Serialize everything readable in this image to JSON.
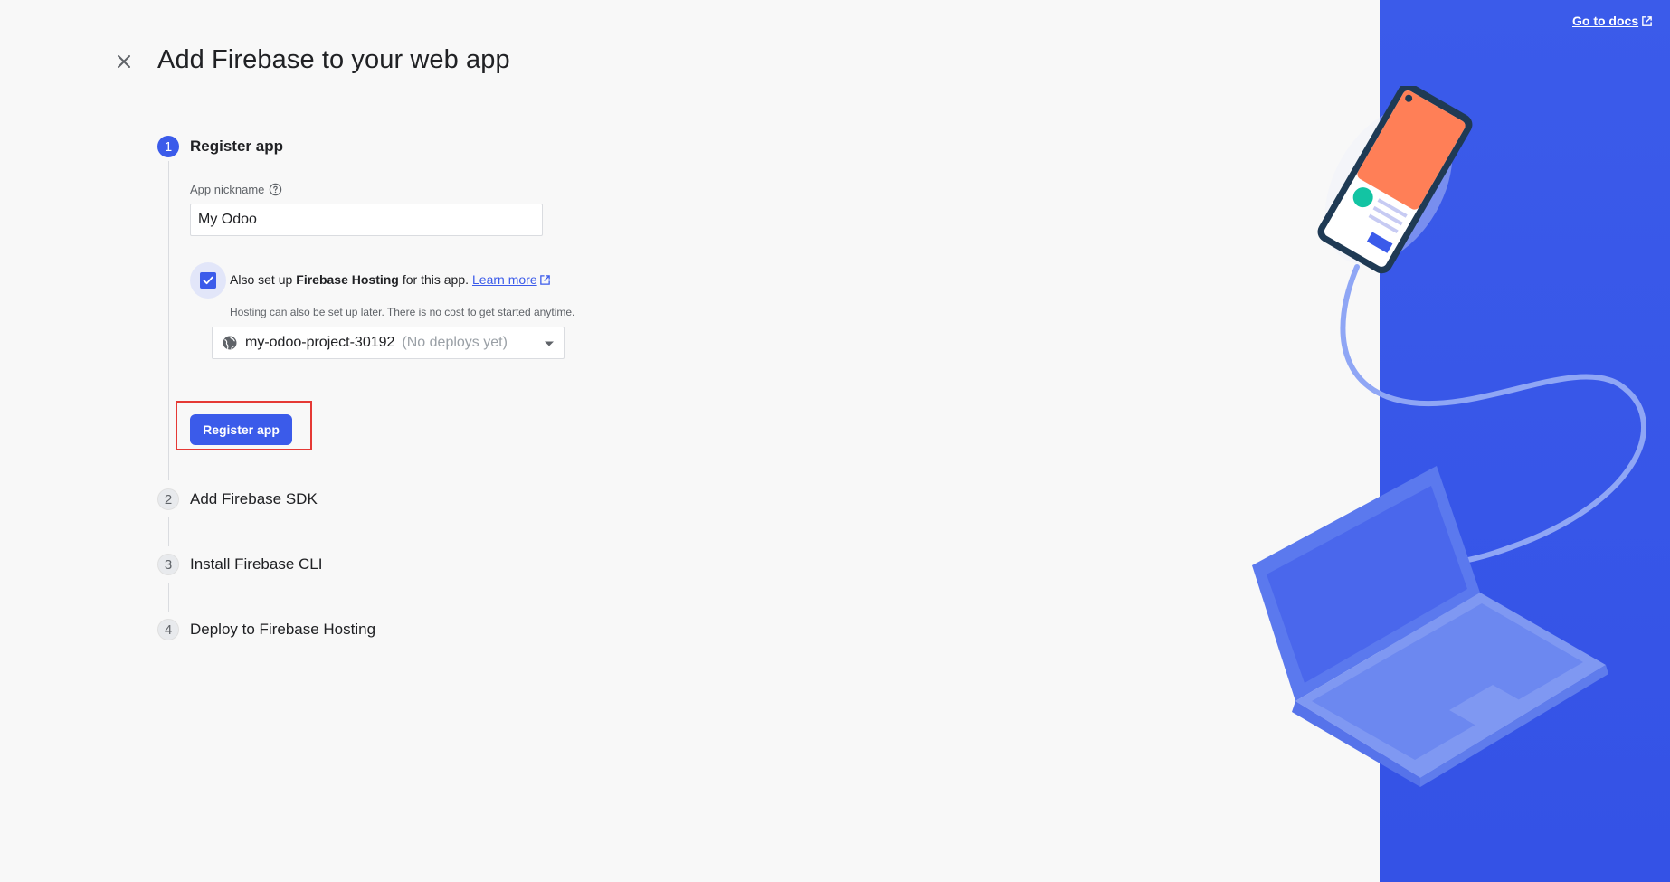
{
  "header": {
    "title": "Add Firebase to your web app",
    "docs_link": "Go to docs"
  },
  "steps": [
    {
      "number": "1",
      "label": "Register app"
    },
    {
      "number": "2",
      "label": "Add Firebase SDK"
    },
    {
      "number": "3",
      "label": "Install Firebase CLI"
    },
    {
      "number": "4",
      "label": "Deploy to Firebase Hosting"
    }
  ],
  "register": {
    "nickname_label": "App nickname",
    "nickname_value": "My Odoo",
    "hosting_prefix": "Also set up",
    "hosting_bold": "Firebase Hosting",
    "hosting_suffix": "for this app.",
    "learn_more": "Learn more",
    "hint": "Hosting can also be set up later. There is no cost to get started anytime.",
    "site_name": "my-odoo-project-30192",
    "site_status": "(No deploys yet)",
    "button_label": "Register app"
  },
  "colors": {
    "accent": "#3b5bea",
    "panel": "#3b5bea",
    "highlight": "#e53935"
  }
}
